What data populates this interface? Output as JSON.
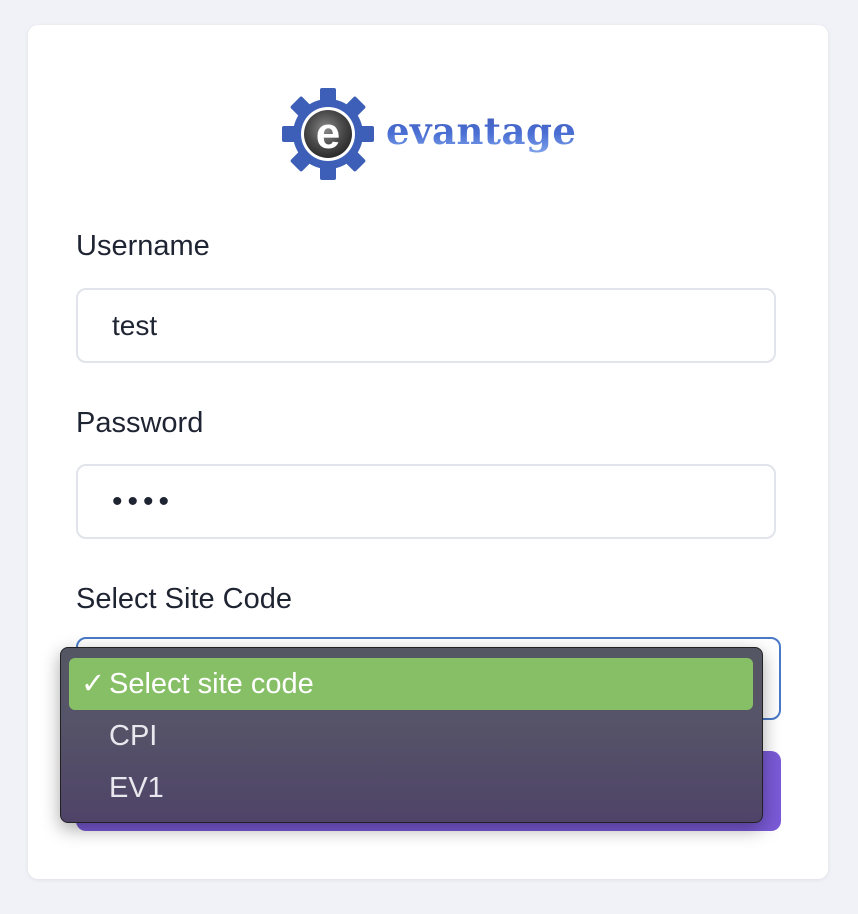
{
  "logo": {
    "text": "evantage",
    "icon": "gear-e-logo-icon"
  },
  "form": {
    "username_label": "Username",
    "username_value": "test",
    "password_label": "Password",
    "password_value": "••••",
    "site_code_label": "Select Site Code"
  },
  "dropdown": {
    "check_mark": "✓",
    "options": [
      {
        "label": "Select site code",
        "selected": true
      },
      {
        "label": "CPI",
        "selected": false
      },
      {
        "label": "EV1",
        "selected": false
      }
    ]
  },
  "colors": {
    "page_bg": "#f0f2f7",
    "select_border": "#4a7ac7",
    "selected_option": "#86bf66",
    "submit_button": "#7a5ad6",
    "logo_blue": "#3a5dc2"
  }
}
